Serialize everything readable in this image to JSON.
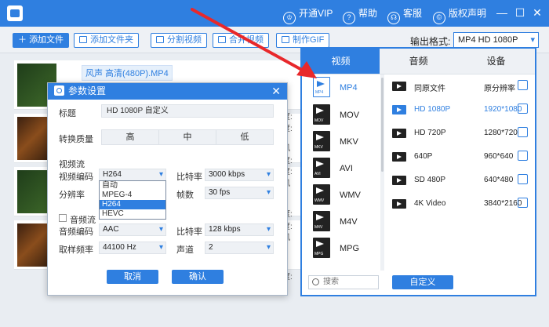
{
  "titlebar": {
    "links": [
      {
        "label": "开通VIP",
        "icon": "crown-icon"
      },
      {
        "label": "帮助",
        "icon": "help-icon"
      },
      {
        "label": "客服",
        "icon": "headset-icon"
      },
      {
        "label": "版权声明",
        "icon": "copyright-icon"
      }
    ],
    "minimize": "—",
    "maximize": "☐",
    "close": "✕"
  },
  "toolbar": {
    "buttons": [
      "添加文件",
      "添加文件夹",
      "分割视频",
      "合并视频",
      "制作GIF"
    ],
    "output_label": "输出格式:",
    "output_value": "MP4  HD 1080P"
  },
  "file_list": {
    "edit_tag": "风声 高清(480P).MP4",
    "side_labels": [
      "风",
      "度:",
      "度:",
      "风",
      "度:",
      "度:",
      "风",
      "度:",
      "度:",
      "风",
      "度:"
    ]
  },
  "dialog": {
    "title": "参数设置",
    "close": "✕",
    "title_label": "标题",
    "title_value": "HD 1080P 自定义",
    "quality_label": "转换质量",
    "quality_options": [
      "高",
      "中",
      "低"
    ],
    "video_section": "视频流",
    "video_codec_label": "视频编码",
    "video_codec_value": "H264",
    "video_bitrate_label": "比特率",
    "video_bitrate_value": "3000 kbps",
    "resolution_label": "分辨率",
    "framerate_label": "帧数",
    "framerate_value": "30 fps",
    "codec_options": [
      "自动",
      "MPEG-4",
      "H264",
      "HEVC"
    ],
    "codec_selected_index": 2,
    "audio_section": "音频流",
    "audio_codec_label": "音频编码",
    "audio_codec_value": "AAC",
    "audio_bitrate_label": "比特率",
    "audio_bitrate_value": "128 kbps",
    "sample_rate_label": "取样频率",
    "sample_rate_value": "44100 Hz",
    "channel_label": "声道",
    "channel_value": "2",
    "cancel": "取消",
    "confirm": "确认"
  },
  "panel": {
    "tabs": [
      "视频",
      "音频",
      "设备"
    ],
    "active_tab": "视频",
    "formats": [
      "MP4",
      "MOV",
      "MKV",
      "AVI",
      "WMV",
      "M4V",
      "MPG"
    ],
    "selected_format": "MP4",
    "presets": [
      {
        "name": "同原文件",
        "res": "原分辨率"
      },
      {
        "name": "HD 1080P",
        "res": "1920*1080"
      },
      {
        "name": "HD 720P",
        "res": "1280*720"
      },
      {
        "name": "640P",
        "res": "960*640"
      },
      {
        "name": "SD 480P",
        "res": "640*480"
      },
      {
        "name": "4K Video",
        "res": "3840*2160"
      }
    ],
    "active_preset_index": 1,
    "search_placeholder": "搜索",
    "custom_button": "自定义"
  },
  "colors": {
    "accent": "#2f7fe0",
    "arrow": "#e8282b"
  }
}
